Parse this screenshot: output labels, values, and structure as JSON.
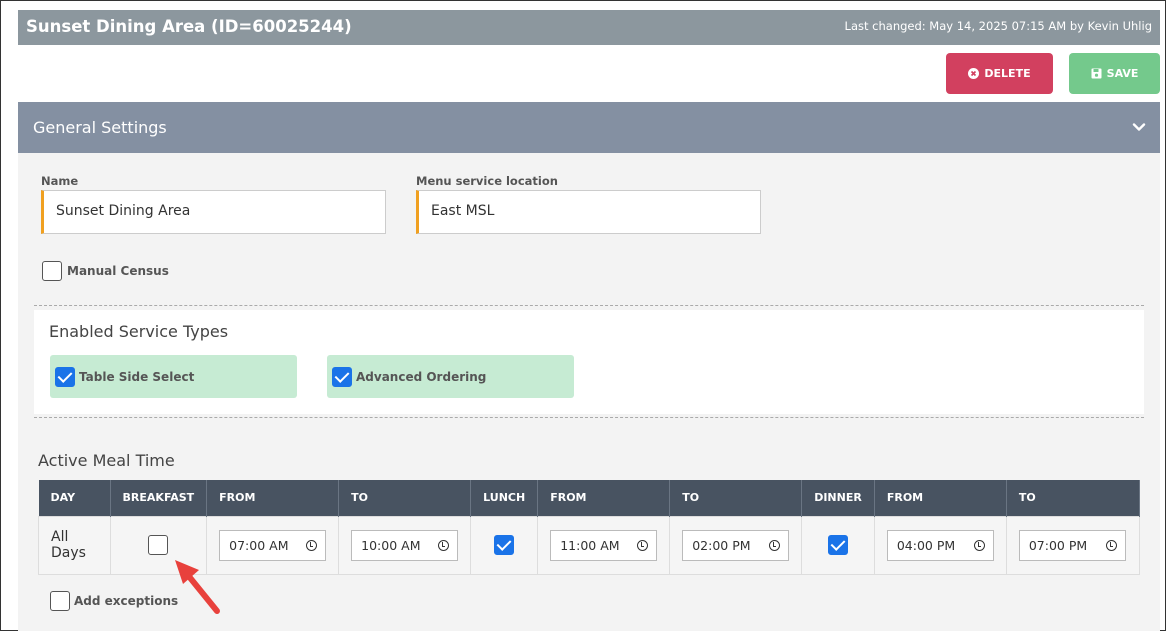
{
  "header": {
    "title": "Sunset Dining Area (ID=60025244)",
    "last_changed": "Last changed: May 14, 2025 07:15 AM by Kevin Uhlig"
  },
  "actions": {
    "delete_label": "DELETE",
    "save_label": "SAVE",
    "delete_color": "#d2405f",
    "save_color": "#74c98c"
  },
  "section": {
    "title": "General Settings"
  },
  "form": {
    "name_label": "Name",
    "name_value": "Sunset Dining Area",
    "location_label": "Menu service location",
    "location_value": "East MSL",
    "manual_census_label": "Manual Census",
    "manual_census_checked": false
  },
  "services": {
    "title": "Enabled Service Types",
    "items": [
      {
        "label": "Table Side Select",
        "checked": true
      },
      {
        "label": "Advanced Ordering",
        "checked": true
      }
    ]
  },
  "meal": {
    "title": "Active Meal Time",
    "headers": [
      "DAY",
      "BREAKFAST",
      "FROM",
      "TO",
      "LUNCH",
      "FROM",
      "TO",
      "DINNER",
      "FROM",
      "TO"
    ],
    "row": {
      "day": "All Days",
      "breakfast_checked": false,
      "breakfast_from": "07:00 AM",
      "breakfast_to": "10:00 AM",
      "lunch_checked": true,
      "lunch_from": "11:00 AM",
      "lunch_to": "02:00 PM",
      "dinner_checked": true,
      "dinner_from": "04:00 PM",
      "dinner_to": "07:00 PM"
    },
    "add_exceptions_label": "Add exceptions"
  },
  "icons": {
    "delete": "x-circle-icon",
    "save": "floppy-disk-icon",
    "collapse": "chevron-down-icon",
    "time": "clock-icon",
    "annotation": "red-arrow-icon"
  }
}
